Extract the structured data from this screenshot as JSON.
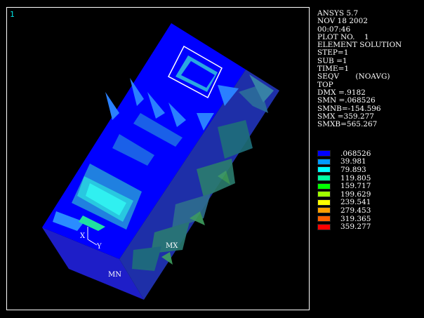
{
  "window": {
    "number": "1"
  },
  "info_lines": [
    "ANSYS 5.7",
    "NOV 18 2002",
    "00:07:46",
    "PLOT NO.    1",
    "ELEMENT SOLUTION",
    "STEP=1",
    "SUB =1",
    "TIME=1",
    "SEQV       (NOAVG)",
    "TOP",
    "DMX =.9182",
    "SMN =.068526",
    "SMNB=-154.596",
    "SMX =359.277",
    "SMXB=565.267"
  ],
  "legend": [
    {
      "value": ".068526",
      "color": "#0000ff"
    },
    {
      "value": "39.981",
      "color": "#009aff"
    },
    {
      "value": "79.893",
      "color": "#00ffff"
    },
    {
      "value": "119.805",
      "color": "#00ffa0"
    },
    {
      "value": "159.717",
      "color": "#00ff00"
    },
    {
      "value": "199.629",
      "color": "#a0ff00"
    },
    {
      "value": "239.541",
      "color": "#ffff00"
    },
    {
      "value": "279.453",
      "color": "#ffa000"
    },
    {
      "value": "319.365",
      "color": "#ff6000"
    },
    {
      "value": "359.277",
      "color": "#ff0000"
    }
  ],
  "markers": {
    "mx": "MX",
    "mn": "MN"
  },
  "triad": {
    "x": "X",
    "y": "Y"
  },
  "colors": {
    "background": "#000000",
    "frame": "#ffffff",
    "window_number": "#00e6e6"
  }
}
